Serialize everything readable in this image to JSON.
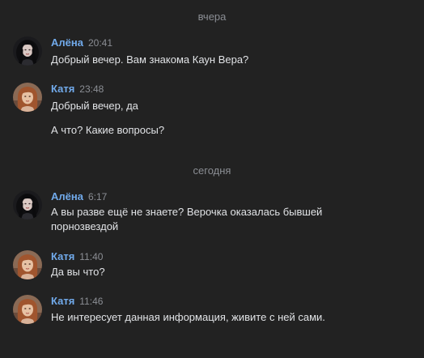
{
  "separators": {
    "yesterday": "вчера",
    "today": "сегодня"
  },
  "messages": [
    {
      "author": "Алёна",
      "time": "20:41",
      "avatar": "alena-avatar",
      "lines": [
        "Добрый вечер. Вам знакома Каун Вера?"
      ]
    },
    {
      "author": "Катя",
      "time": "23:48",
      "avatar": "katya-avatar",
      "lines": [
        "Добрый вечер, да",
        "А что? Какие вопросы?"
      ]
    },
    {
      "author": "Алёна",
      "time": "6:17",
      "avatar": "alena-avatar",
      "lines": [
        "А вы разве ещё не знаете? Верочка оказалась бывшей порнозвездой"
      ]
    },
    {
      "author": "Катя",
      "time": "11:40",
      "avatar": "katya-avatar",
      "lines": [
        "Да вы что?"
      ]
    },
    {
      "author": "Катя",
      "time": "11:46",
      "avatar": "katya-avatar",
      "lines": [
        "Не интересует данная информация, живите с ней сами."
      ]
    }
  ],
  "colors": {
    "background": "#222222",
    "author_name": "#71aaeb",
    "meta_text": "#8b8e94",
    "message_text": "#e1e3e6"
  }
}
